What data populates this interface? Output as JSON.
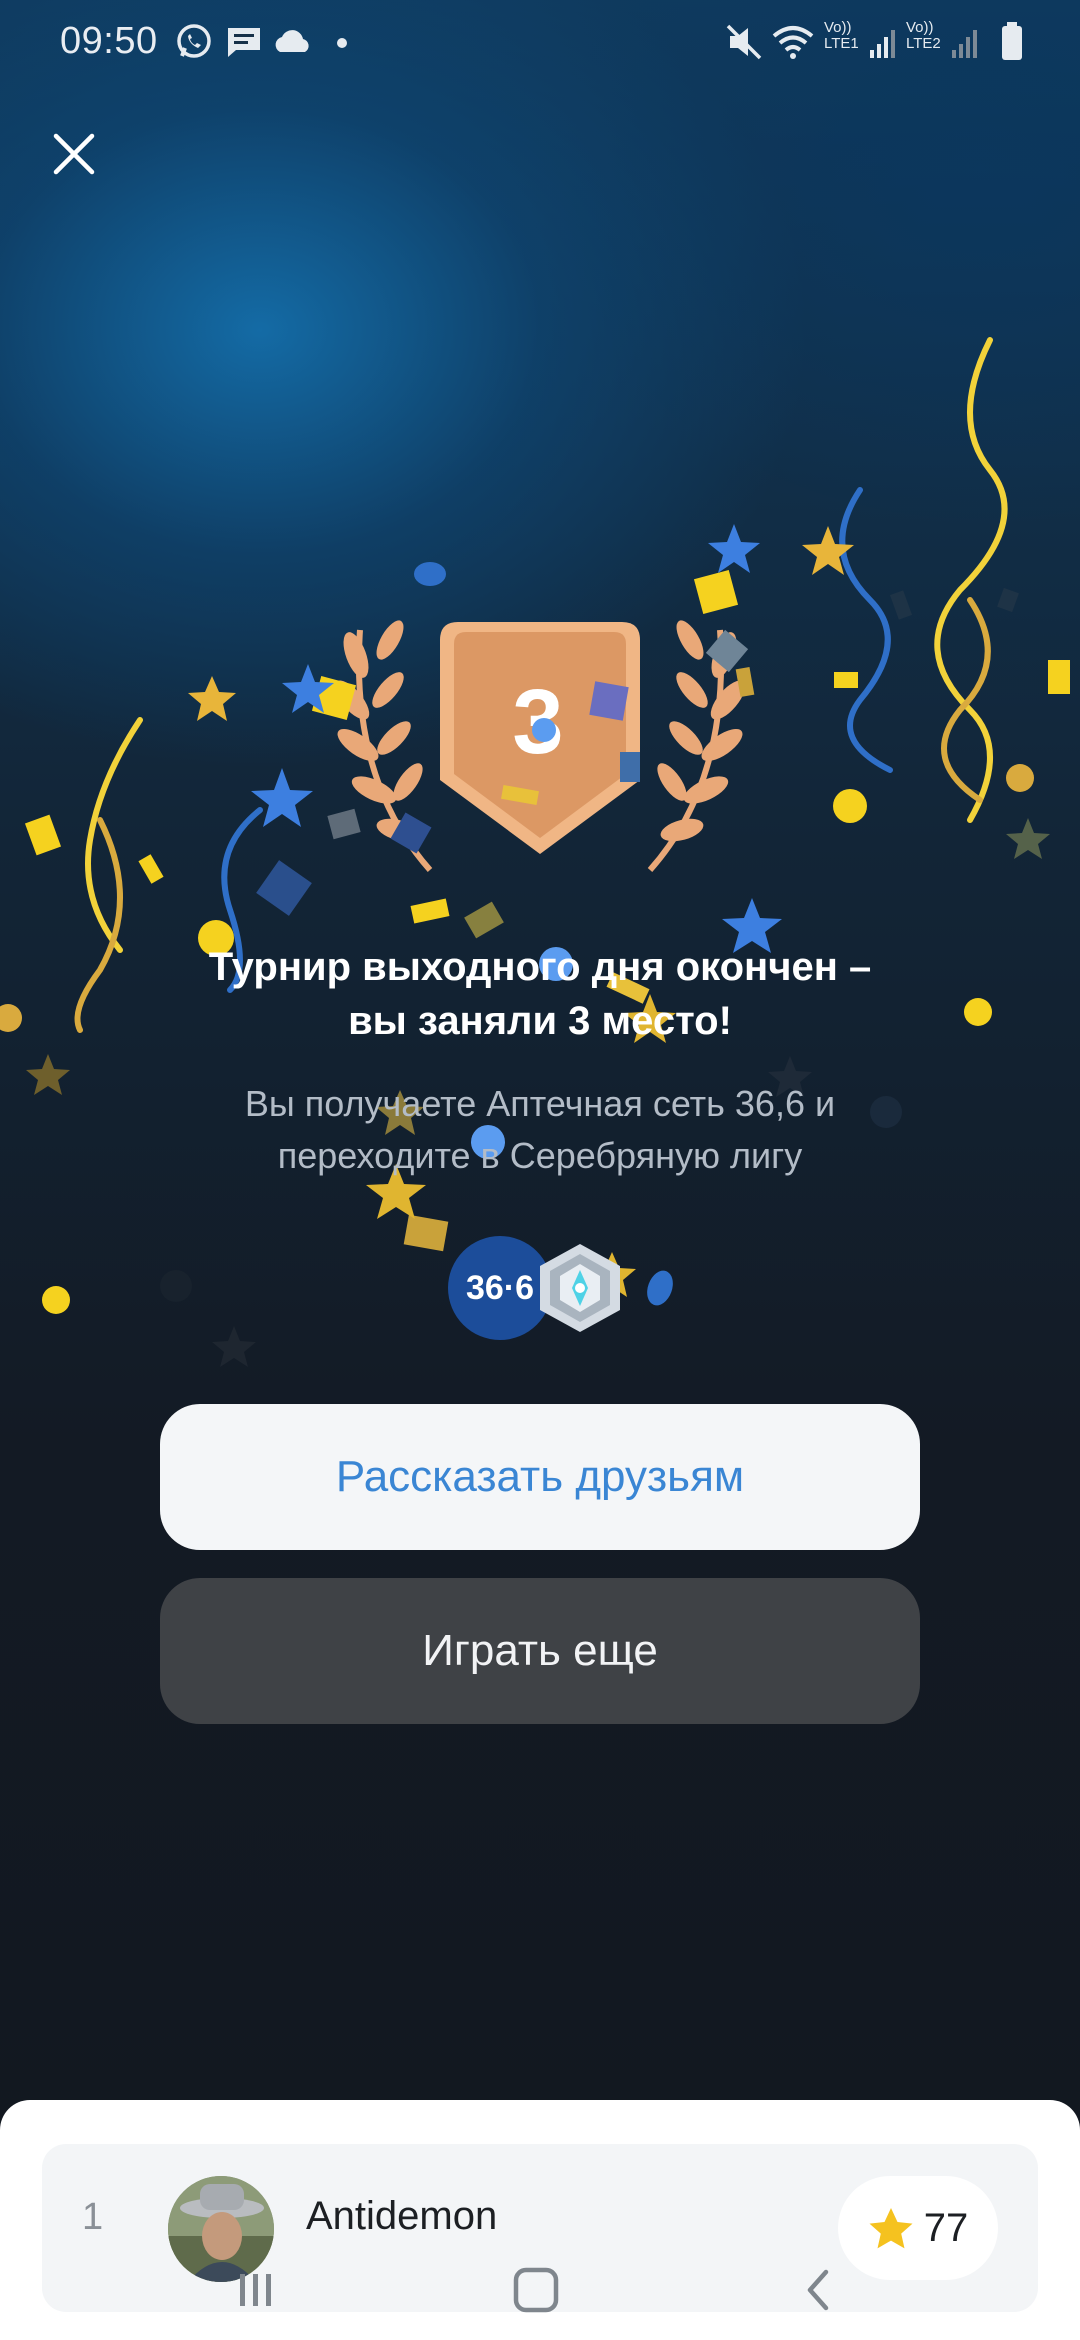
{
  "status_bar": {
    "time": "09:50",
    "left_icons": [
      "whatsapp-icon",
      "message-icon",
      "cloud-icon",
      "dot-icon"
    ],
    "right_icons": [
      "mute-icon",
      "wifi-icon",
      "lte1-signal-icon",
      "lte2-signal-icon",
      "battery-icon"
    ],
    "lte1_label": "LTE1",
    "lte2_label": "LTE2",
    "volte_label": "Vo))"
  },
  "header": {
    "close_icon": "close-icon"
  },
  "medal": {
    "place": "3",
    "color": "#e8a574"
  },
  "result": {
    "title_line1": "Турнир выходного дня окончен –",
    "title_line2": "вы заняли 3 место!",
    "subtitle_line1": "Вы получаете Аптечная сеть 36,6 и",
    "subtitle_line2": "переходите в Серебряную лигу"
  },
  "rewards": {
    "partner_badge_text": "36·6",
    "league_icon": "silver-league-icon"
  },
  "actions": {
    "share_label": "Рассказать друзьям",
    "play_again_label": "Играть еще"
  },
  "leaderboard": {
    "rows": [
      {
        "rank": "1",
        "name": "Antidemon",
        "score": "77",
        "score_icon": "star-icon"
      }
    ]
  },
  "nav": {
    "recents_icon": "recents-icon",
    "home_icon": "home-icon",
    "back_icon": "back-icon"
  },
  "colors": {
    "accent_blue": "#3a86d4",
    "confetti_yellow": "#f5d21f",
    "confetti_blue": "#3d7fe0",
    "bronze": "#e8a574"
  }
}
